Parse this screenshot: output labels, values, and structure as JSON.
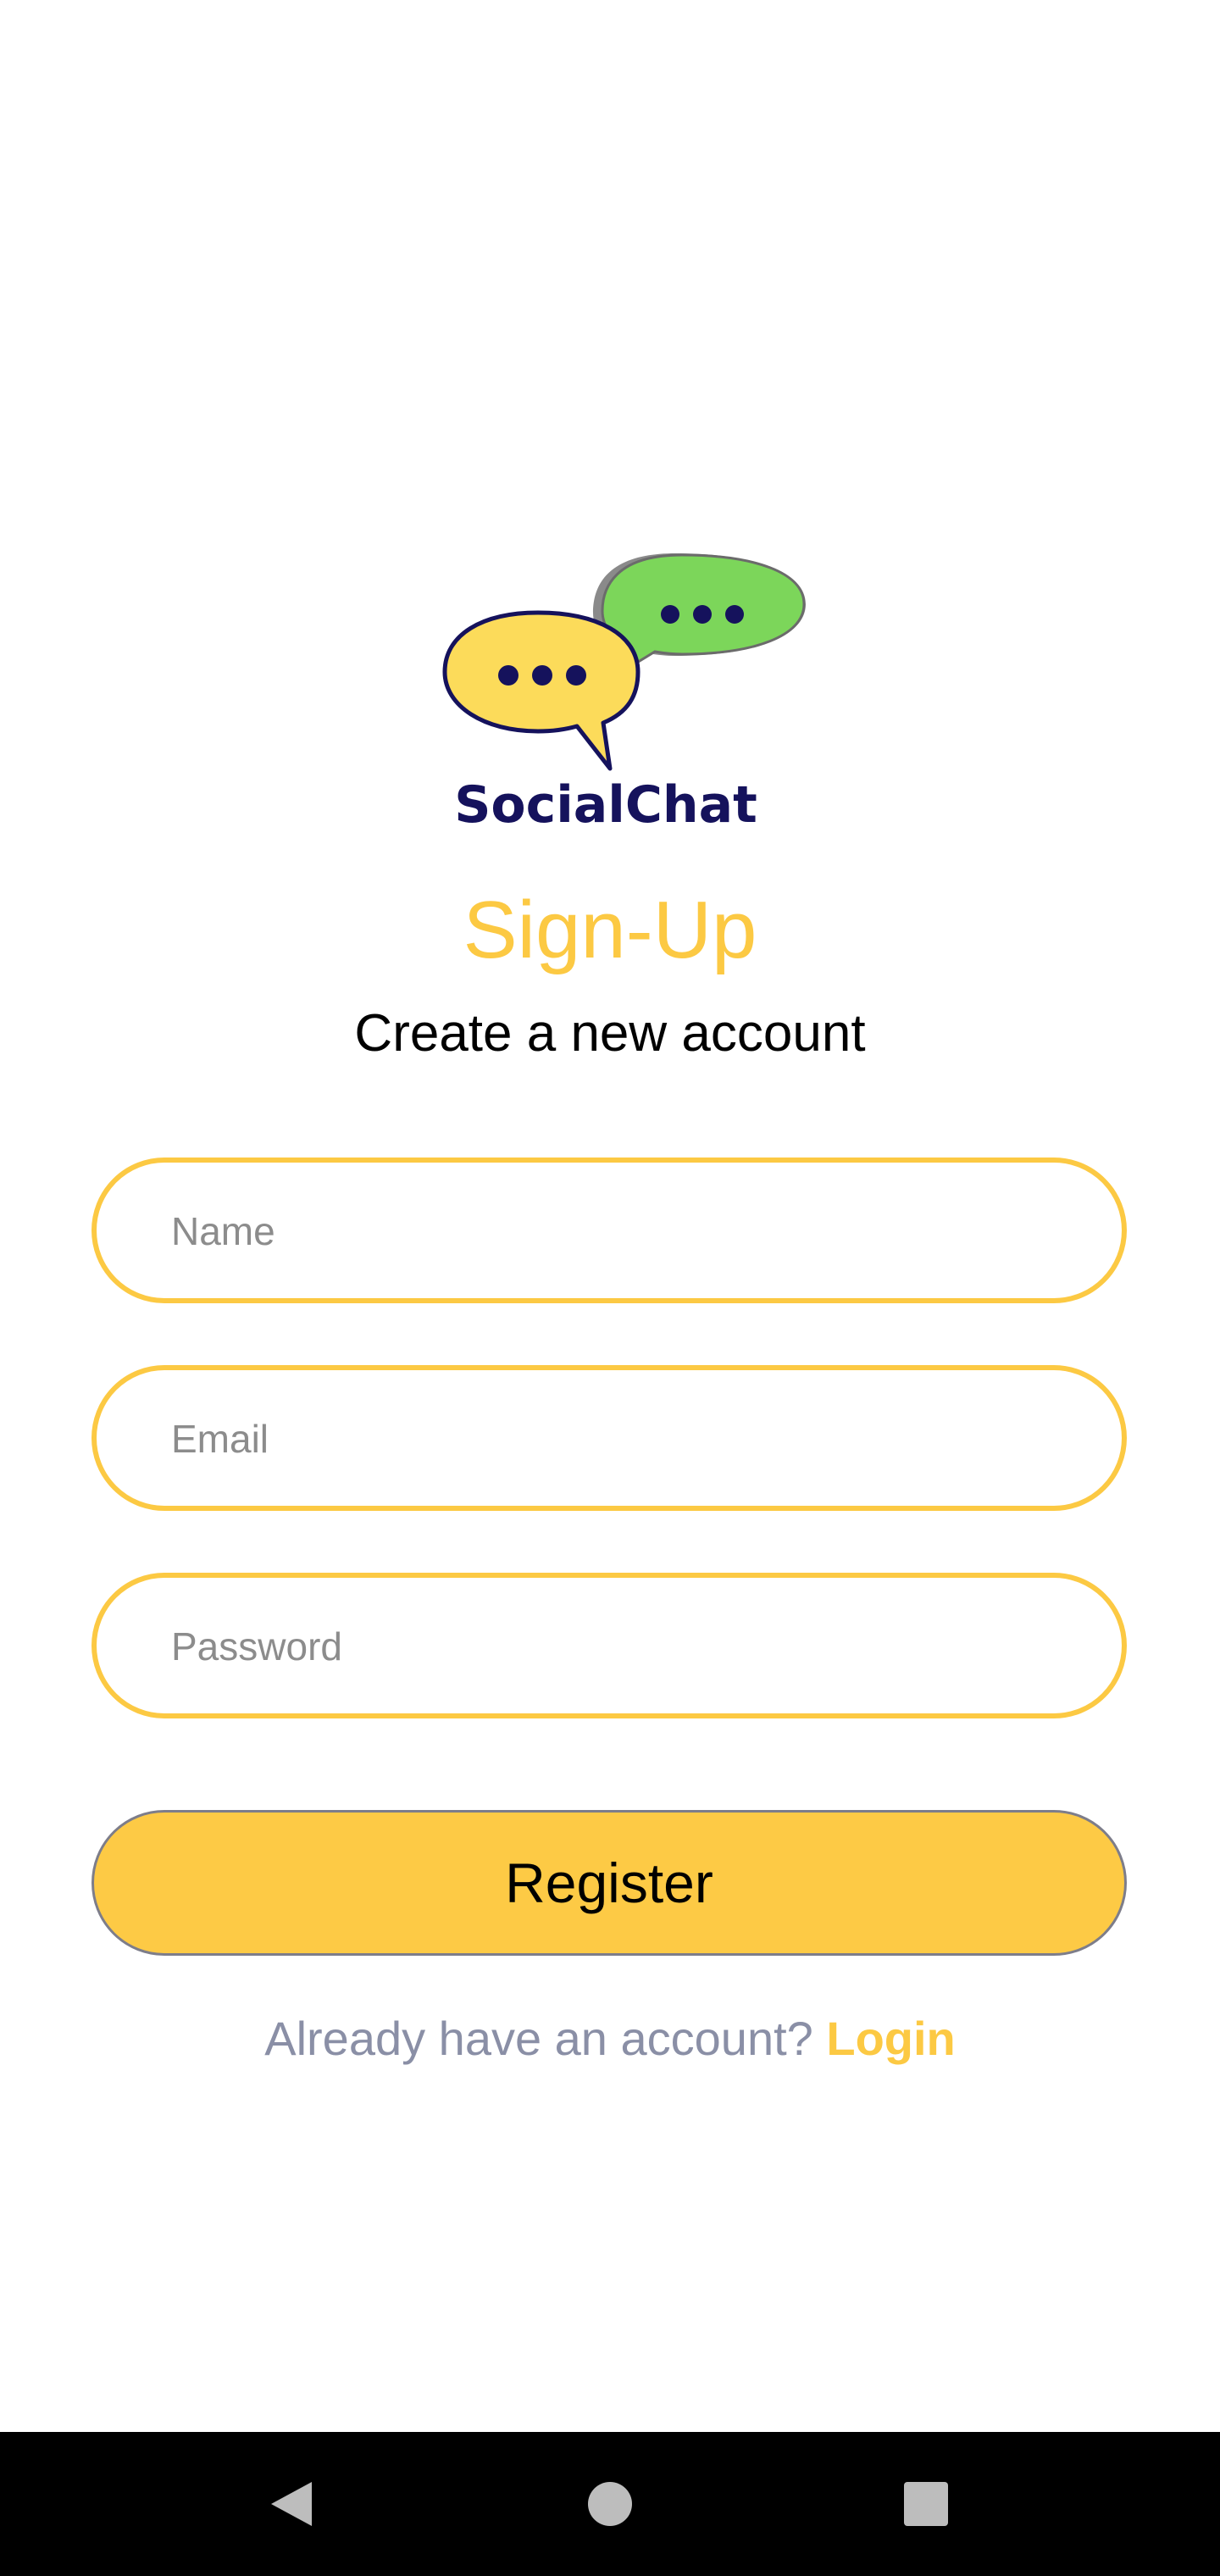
{
  "logo": {
    "brand_text": "SocialChat",
    "colors": {
      "yellow_bubble": "#fcdb5a",
      "green_bubble": "#7cd65a",
      "ink": "#15125c"
    }
  },
  "header": {
    "title": "Sign-Up",
    "subtitle": "Create a new account"
  },
  "form": {
    "name_placeholder": "Name",
    "email_placeholder": "Email",
    "password_placeholder": "Password",
    "name_value": "",
    "email_value": "",
    "password_value": ""
  },
  "actions": {
    "register_label": "Register",
    "login_prompt": "Already have an account? ",
    "login_link": "Login"
  },
  "navbar": {
    "icons": [
      "back-icon",
      "home-icon",
      "recents-icon"
    ]
  },
  "colors": {
    "accent": "#fcc943",
    "button_fill": "#fdca45",
    "muted_text": "#8a8fa6",
    "navbar": "#000000"
  }
}
